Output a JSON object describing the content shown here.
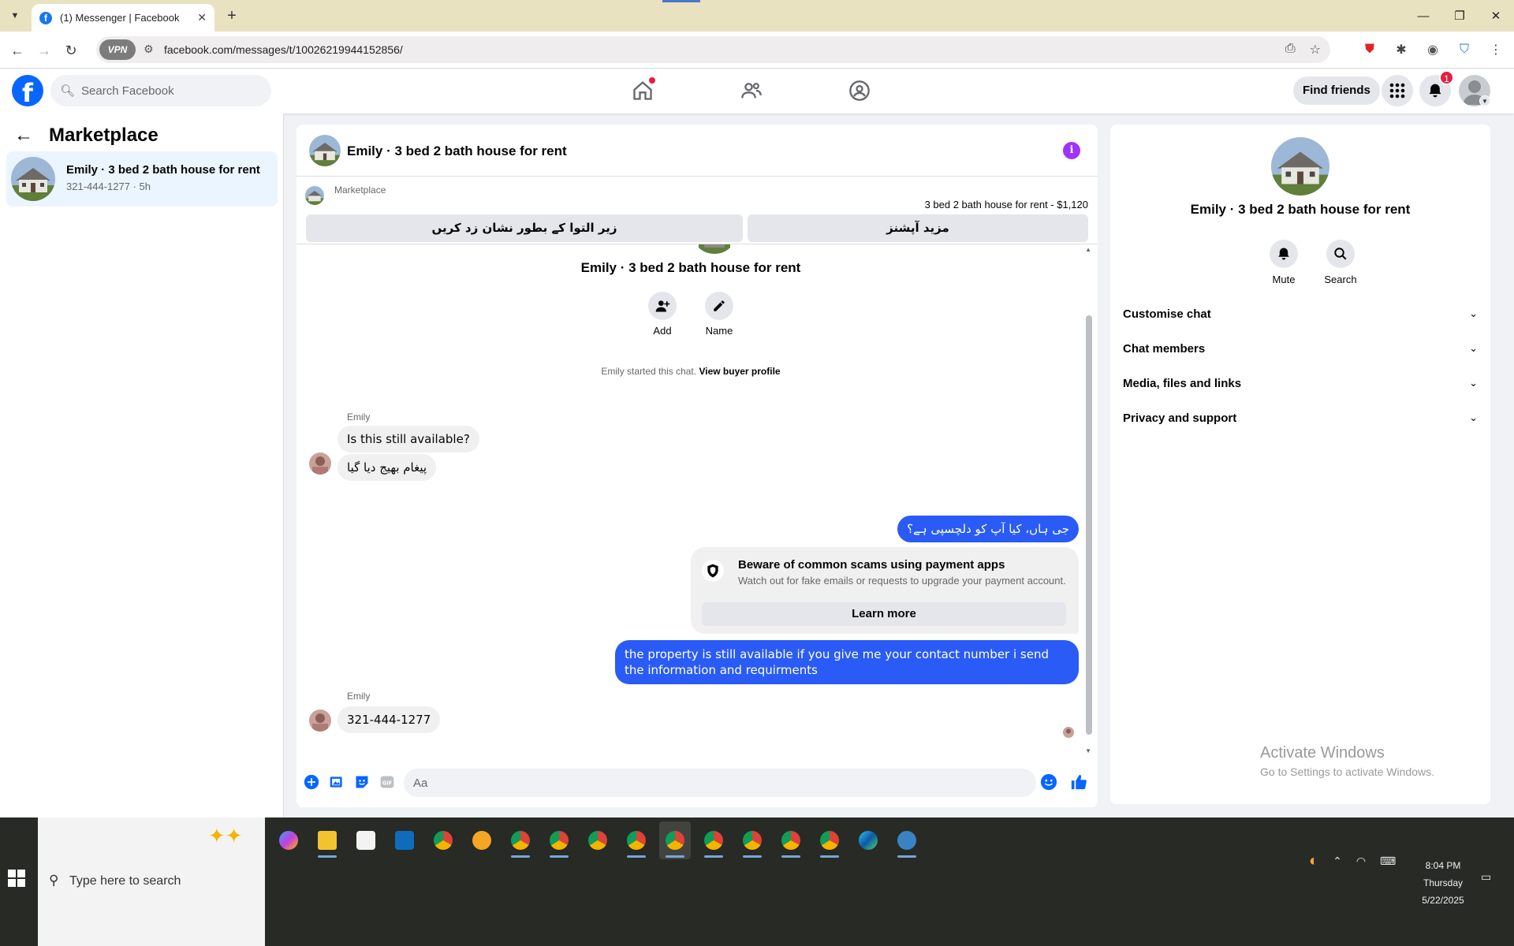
{
  "browser": {
    "tab_title": "(1) Messenger | Facebook",
    "url": "facebook.com/messages/t/10026219944152856/",
    "vpn_label": "VPN"
  },
  "fb_header": {
    "search_placeholder": "Search Facebook",
    "find_friends": "Find friends",
    "notification_count": "1",
    "brand_color": "#0866ff"
  },
  "sidebar": {
    "title": "Marketplace",
    "conversation": {
      "name": "Emily · 3 bed 2 bath house for rent",
      "subtitle": "321-444-1277 · 5h"
    }
  },
  "chat": {
    "header_title": "Emily · 3 bed 2 bath house for rent",
    "marketplace_label": "Marketplace",
    "listing": "3 bed 2 bath house for rent - $1,120",
    "btn_mark_pending": "زیر التوا کے بطور نشان زد کریں",
    "btn_more_options": "مزید آپشنز",
    "intro_title": "Emily · 3 bed 2 bath house for rent",
    "action_add": "Add",
    "action_name": "Name",
    "started_text": "Emily started this chat.",
    "view_buyer_profile": "View buyer profile",
    "sender_name": "Emily",
    "msg1": "Is this still available?",
    "msg2": "پیغام بھیج دیا گیا",
    "msg3": "جی ہاں، کیا آپ کو دلچسپی ہے؟",
    "scam_title": "Beware of common scams using payment apps",
    "scam_desc": "Watch out for fake emails or requests to upgrade your payment account.",
    "learn_more": "Learn more",
    "msg4": "the property is still available if you give me your contact number i send the information and requirments",
    "sender_name_2": "Emily",
    "msg5": "321-444-1277",
    "composer_placeholder": "Aa",
    "outgoing_color": "#2a5bf6"
  },
  "right_panel": {
    "name": "Emily · 3 bed 2 bath house for rent",
    "mute": "Mute",
    "search": "Search",
    "sections": [
      "Customise chat",
      "Chat members",
      "Media, files and links",
      "Privacy and support"
    ],
    "activate_title": "Activate Windows",
    "activate_sub": "Go to Settings to activate Windows."
  },
  "taskbar": {
    "search_text": "Type here to search",
    "time": "8:04 PM",
    "day": "Thursday",
    "date": "5/22/2025"
  }
}
